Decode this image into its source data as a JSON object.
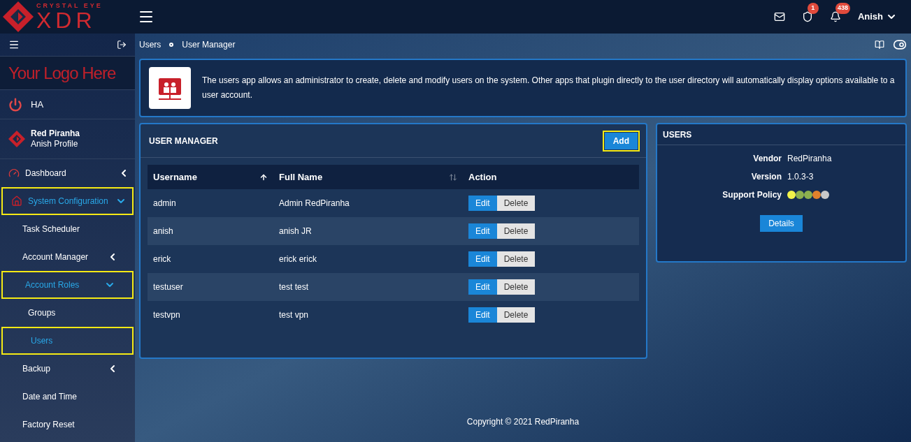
{
  "brand": {
    "tagline": "CRYSTAL EYE",
    "product": "XDR"
  },
  "topbar": {
    "badges": [
      {
        "kind": "mail"
      },
      {
        "kind": "shield",
        "count": "1"
      },
      {
        "kind": "bell",
        "count": "438"
      }
    ],
    "user": "Anish"
  },
  "sidebar": {
    "logo_text": "Your Logo Here",
    "ha": "HA",
    "profile": {
      "name": "Red Piranha",
      "subtitle": "Anish Profile"
    },
    "items": [
      {
        "label": "Dashboard",
        "kind": "group",
        "expanded": false,
        "selected": false,
        "highlighted": false
      },
      {
        "label": "System Configuration",
        "kind": "group",
        "expanded": true,
        "selected": true,
        "highlighted": true,
        "children": [
          {
            "label": "Task Scheduler",
            "kind": "link",
            "selected": false,
            "highlighted": false
          },
          {
            "label": "Account Manager",
            "kind": "group",
            "expanded": false,
            "selected": false,
            "highlighted": false
          },
          {
            "label": "Account Roles",
            "kind": "group",
            "expanded": true,
            "selected": true,
            "highlighted": true,
            "children": [
              {
                "label": "Groups",
                "kind": "link",
                "selected": false,
                "highlighted": false
              },
              {
                "label": "Users",
                "kind": "link",
                "selected": true,
                "highlighted": true
              }
            ]
          },
          {
            "label": "Backup",
            "kind": "group",
            "expanded": false,
            "selected": false,
            "highlighted": false
          },
          {
            "label": "Date and Time",
            "kind": "link",
            "selected": false,
            "highlighted": false
          },
          {
            "label": "Factory Reset",
            "kind": "link",
            "selected": false,
            "highlighted": false
          }
        ]
      }
    ]
  },
  "breadcrumb": [
    "Users",
    "User Manager"
  ],
  "info": "The users app allows an administrator to create, delete and modify users on the system. Other apps that plugin directly to the user directory will automatically display options available to a user account.",
  "user_manager": {
    "title": "USER MANAGER",
    "add_button": {
      "label": "Add",
      "highlighted": true
    },
    "columns": [
      {
        "label": "Username",
        "sortable": true,
        "sorted": true
      },
      {
        "label": "Full Name",
        "sortable": true,
        "sorted": false
      },
      {
        "label": "Action",
        "sortable": false
      }
    ],
    "rows": [
      {
        "username": "admin",
        "full_name": "Admin RedPiranha",
        "edit": "Edit",
        "delete": "Delete"
      },
      {
        "username": "anish",
        "full_name": "anish JR",
        "edit": "Edit",
        "delete": "Delete"
      },
      {
        "username": "erick",
        "full_name": "erick erick",
        "edit": "Edit",
        "delete": "Delete"
      },
      {
        "username": "testuser",
        "full_name": "test test",
        "edit": "Edit",
        "delete": "Delete"
      },
      {
        "username": "testvpn",
        "full_name": "test vpn",
        "edit": "Edit",
        "delete": "Delete"
      }
    ]
  },
  "users_panel": {
    "title": "USERS",
    "fields": [
      {
        "label": "Vendor",
        "value": "RedPiranha"
      },
      {
        "label": "Version",
        "value": "1.0.3-3"
      }
    ],
    "support_label": "Support Policy",
    "support_dots": [
      {
        "color": "#f2f24a"
      },
      {
        "color": "#8db04f"
      },
      {
        "color": "#8db04f"
      },
      {
        "color": "#e0812c"
      },
      {
        "color": "#c8c8c8"
      }
    ],
    "details_button": "Details"
  },
  "footer": "Copyright © 2021 RedPiranha"
}
